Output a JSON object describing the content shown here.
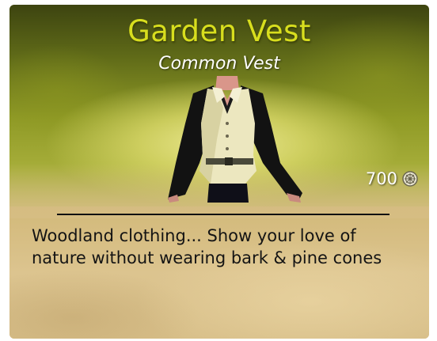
{
  "item": {
    "name": "Garden Vest",
    "type": "Common Vest",
    "price": "700",
    "description": "Woodland clothing... Show your love of nature without wearing bark & pine cones"
  },
  "icons": {
    "currency": "coin-icon",
    "item": "vest-icon"
  },
  "colors": {
    "title": "#d8de1e",
    "subtitle": "#ffffff",
    "background_top": "#5f6a18",
    "parchment": "#d6bd83"
  }
}
